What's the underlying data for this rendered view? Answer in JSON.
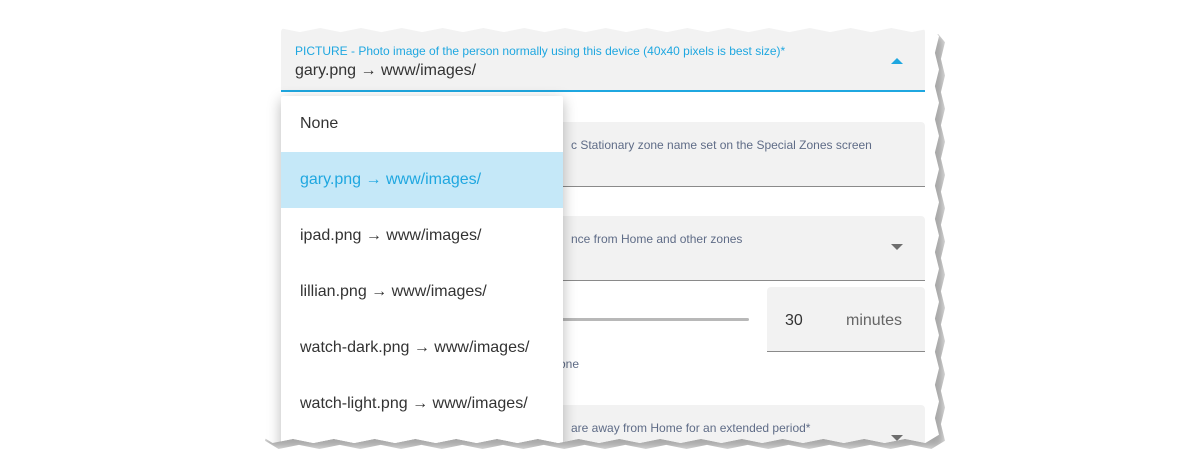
{
  "picture": {
    "label": "PICTURE - Photo image of the person normally using this device (40x40 pixels is best size)*",
    "value": "gary.png → www/images/"
  },
  "stationary_field": {
    "label_visible": "c Stationary zone name set on the Special Zones screen"
  },
  "zone_field": {
    "label_visible": "nce from Home and other zones"
  },
  "minutes_field": {
    "value": "30",
    "unit": "minutes"
  },
  "helper_text_visible": "one",
  "away_field": {
    "label_visible": "are away from Home for an extended period*"
  },
  "menu": {
    "items": [
      {
        "label": "None",
        "selected": false
      },
      {
        "label": "gary.png → www/images/",
        "selected": true
      },
      {
        "label": "ipad.png → www/images/",
        "selected": false
      },
      {
        "label": "lillian.png → www/images/",
        "selected": false
      },
      {
        "label": "watch-dark.png → www/images/",
        "selected": false
      },
      {
        "label": "watch-light.png → www/images/",
        "selected": false
      }
    ]
  },
  "colors": {
    "accent": "#1fa7e0",
    "selected_bg": "#c5e8f8",
    "field_bg": "#f2f2f2",
    "label_text": "#5f6c87"
  }
}
